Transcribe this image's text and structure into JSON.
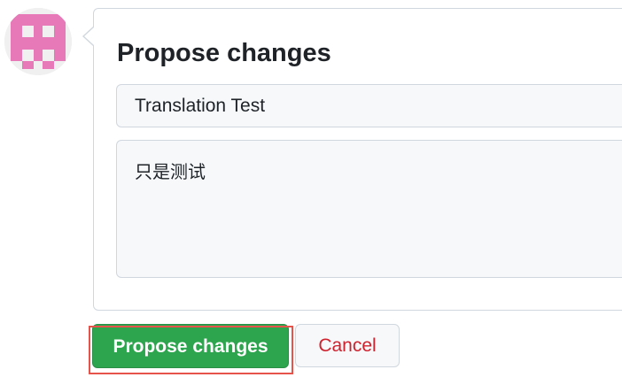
{
  "form": {
    "title": "Propose changes",
    "commit_title_value": "Translation Test",
    "commit_body_value": "只是测试"
  },
  "actions": {
    "propose_label": "Propose changes",
    "cancel_label": "Cancel"
  },
  "colors": {
    "propose_button_bg": "#2da44e",
    "cancel_text": "#cf222e",
    "avatar_fill": "#e879b9",
    "highlight_border": "#e5534b"
  },
  "icons": {
    "avatar": "identicon-avatar"
  }
}
